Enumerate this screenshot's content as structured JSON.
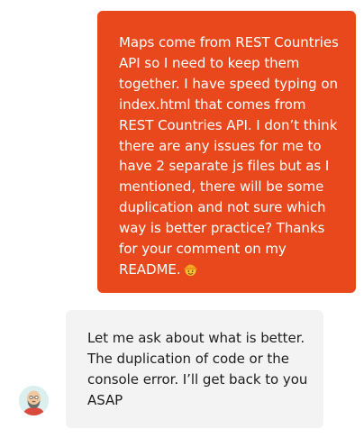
{
  "messages": {
    "sent": {
      "text": "Maps come from REST Countries API so I need to keep them together. I have speed typing on index.html that comes from REST Countries API. I don’t think there are any issues for me to have 2 separate js files but as I mentioned, there will be some duplication and not sure which way is better practice? Thanks for your comment on my README.",
      "emoji_icon": "hard-hat-smiley-emoji",
      "color": "#e8481b"
    },
    "received": {
      "text": "Let me ask about what is better. The duplication of code or the console error. I’ll get back to you ASAP",
      "avatar_icon": "bald-bearded-man-avatar",
      "color": "#f3f3f3"
    }
  }
}
